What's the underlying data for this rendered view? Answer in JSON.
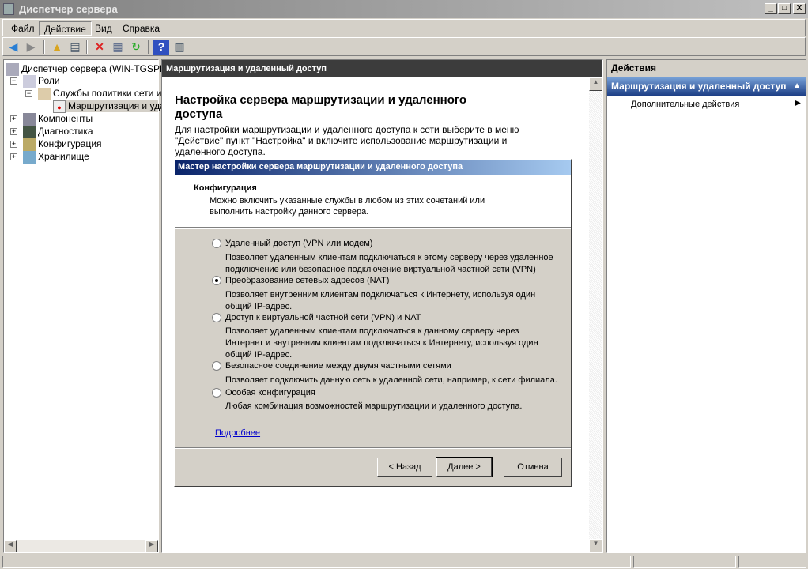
{
  "window": {
    "title": "Диспетчер сервера",
    "minimize": "_",
    "maximize": "□",
    "close": "X"
  },
  "menu": [
    "Файл",
    "Действие",
    "Вид",
    "Справка"
  ],
  "toolbar": [
    "back-icon",
    "forward-icon",
    "up-icon",
    "show-hide-tree-icon",
    "delete-icon",
    "properties-icon",
    "refresh-icon",
    "help-icon",
    "show-hide-action-pane-icon"
  ],
  "tree": {
    "root": "Диспетчер сервера (WIN-TGSPRG",
    "roles": "Роли",
    "nps": "Службы политики сети и ...",
    "rras": "Маршрутизация и уда",
    "features": "Компоненты",
    "diagnostics": "Диагностика",
    "configuration": "Конфигурация",
    "storage": "Хранилище"
  },
  "center": {
    "header": "Маршрутизация и удаленный доступ",
    "heading": "Настройка сервера маршрутизации и удаленного доступа",
    "description": "Для настройки маршрутизации и удаленного доступа к сети выберите в меню \"Действие\" пункт \"Настройка\" и включите использование маршрутизации и удаленного доступа."
  },
  "wizard": {
    "title": "Мастер настройки сервера маршрутизации и удаленного доступа",
    "section": "Конфигурация",
    "section_desc": "Можно включить указанные службы в любом из этих сочетаний или выполнить настройку данного сервера.",
    "options": [
      {
        "label": "Удаленный доступ (VPN или модем)",
        "desc": "Позволяет удаленным клиентам подключаться к этому серверу через удаленное подключение или безопасное подключение виртуальной частной сети (VPN)",
        "selected": false
      },
      {
        "label": "Преобразование сетевых адресов (NAT)",
        "desc": "Позволяет внутренним клиентам подключаться к Интернету, используя один общий IP-адрес.",
        "selected": true
      },
      {
        "label": "Доступ к виртуальной частной сети (VPN) и NAT",
        "desc": "Позволяет удаленным клиентам подключаться к данному серверу через Интернет и внутренним клиентам подключаться к Интернету, используя один общий IP-адрес.",
        "selected": false
      },
      {
        "label": "Безопасное соединение между двумя частными сетями",
        "desc": "Позволяет подключить данную сеть к удаленной сети, например, к сети филиала.",
        "selected": false
      },
      {
        "label": "Особая конфигурация",
        "desc": "Любая комбинация возможностей маршрутизации и удаленного доступа.",
        "selected": false
      }
    ],
    "more_link": "Подробнее",
    "back": "< Назад",
    "next": "Далее >",
    "cancel": "Отмена"
  },
  "actions": {
    "header": "Действия",
    "group": "Маршрутизация и удаленный доступ",
    "item": "Дополнительные действия"
  }
}
